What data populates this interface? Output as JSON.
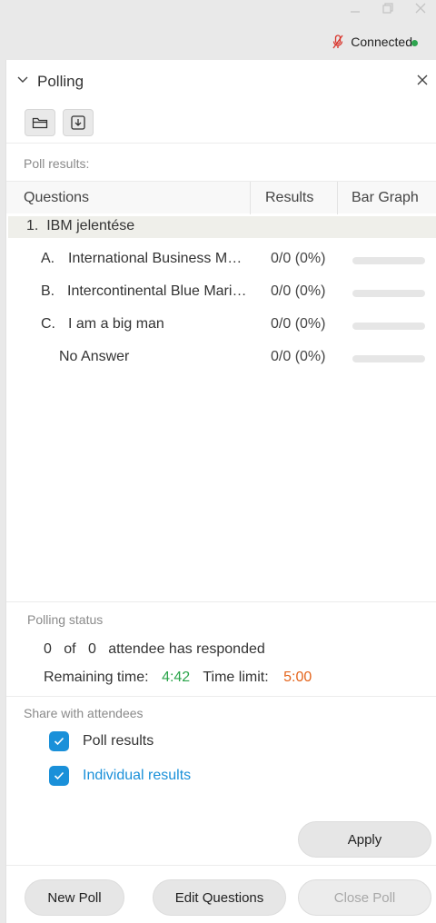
{
  "window": {
    "status_label": "Connected",
    "status_color": "#2ea44f",
    "mic_icon": "mic-muted-icon",
    "controls": [
      "minimize-icon",
      "restore-icon",
      "close-icon"
    ]
  },
  "panel": {
    "title": "Polling",
    "toolbar": {
      "open_icon": "folder-open-icon",
      "save_icon": "download-icon"
    }
  },
  "results": {
    "section_label": "Poll results:",
    "columns": {
      "questions": "Questions",
      "results": "Results",
      "bar_graph": "Bar Graph"
    },
    "question": {
      "number": "1.",
      "text": "IBM jelentése"
    },
    "answers": [
      {
        "letter": "A.",
        "text": "International Business Machines",
        "result": "0/0 (0%)",
        "fraction": 0
      },
      {
        "letter": "B.",
        "text": "Intercontinental Blue Marines",
        "result": "0/0 (0%)",
        "fraction": 0
      },
      {
        "letter": "C.",
        "text": "I am a big man",
        "result": "0/0 (0%)",
        "fraction": 0
      },
      {
        "letter": "",
        "text": "No Answer",
        "result": "0/0 (0%)",
        "fraction": 0
      }
    ]
  },
  "status": {
    "section_label": "Polling status",
    "responded": "0",
    "of_word": "of",
    "total": "0",
    "responded_suffix": "attendee has responded",
    "remaining_label": "Remaining time:",
    "remaining_value": "4:42",
    "limit_label": "Time limit:",
    "limit_value": "5:00"
  },
  "share": {
    "section_label": "Share with attendees",
    "options": [
      {
        "label": "Poll results",
        "checked": true,
        "color": "#333333"
      },
      {
        "label": "Individual results",
        "checked": true,
        "color": "#1a90d9"
      }
    ],
    "apply_label": "Apply"
  },
  "footer": {
    "new_poll": "New Poll",
    "edit_questions": "Edit Questions",
    "close_poll": "Close Poll"
  }
}
